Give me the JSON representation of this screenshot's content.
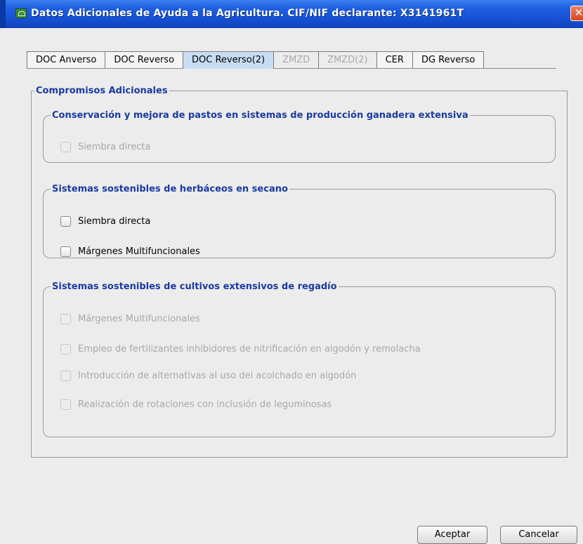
{
  "window": {
    "title": "Datos Adicionales de Ayuda a la Agricultura. CIF/NIF declarante: X3141961T",
    "close_label": "✕"
  },
  "tabs": [
    {
      "label": "DOC Anverso",
      "state": "normal"
    },
    {
      "label": "DOC Reverso",
      "state": "normal"
    },
    {
      "label": "DOC Reverso(2)",
      "state": "selected"
    },
    {
      "label": "ZMZD",
      "state": "disabled"
    },
    {
      "label": "ZMZD(2)",
      "state": "disabled"
    },
    {
      "label": "CER",
      "state": "normal"
    },
    {
      "label": "DG Reverso",
      "state": "normal"
    }
  ],
  "main": {
    "section_title": "Compromisos Adicionales",
    "groups": [
      {
        "title": "Conservación y mejora de pastos en sistemas de producción ganadera extensiva",
        "items": [
          {
            "label": "Siembra directa",
            "checked": false,
            "enabled": false
          }
        ]
      },
      {
        "title": "Sistemas sostenibles de herbáceos en secano",
        "items": [
          {
            "label": "Siembra directa",
            "checked": false,
            "enabled": true
          },
          {
            "label": "Márgenes Multifuncionales",
            "checked": false,
            "enabled": true
          }
        ]
      },
      {
        "title": "Sistemas sostenibles de cultivos extensivos de regadío",
        "items": [
          {
            "label": "Márgenes Multifuncionales",
            "checked": false,
            "enabled": false
          },
          {
            "label": "Empleo de fertilizantes inhibidores de nitrificación en algodón y remolacha",
            "checked": false,
            "enabled": false
          },
          {
            "label": "Introducción de alternativas al uso del acolchado en algodón",
            "checked": false,
            "enabled": false
          },
          {
            "label": "Realización de rotaciones con inclusión de leguminosas",
            "checked": false,
            "enabled": false
          }
        ]
      }
    ]
  },
  "buttons": {
    "accept_label": "Aceptar",
    "cancel_label": "Cancelar"
  },
  "colors": {
    "titlebar": "#1550d4",
    "group_title": "#1a3aa0",
    "selected_tab": "#c8ddf4",
    "disabled_text": "#a8a8a8"
  }
}
